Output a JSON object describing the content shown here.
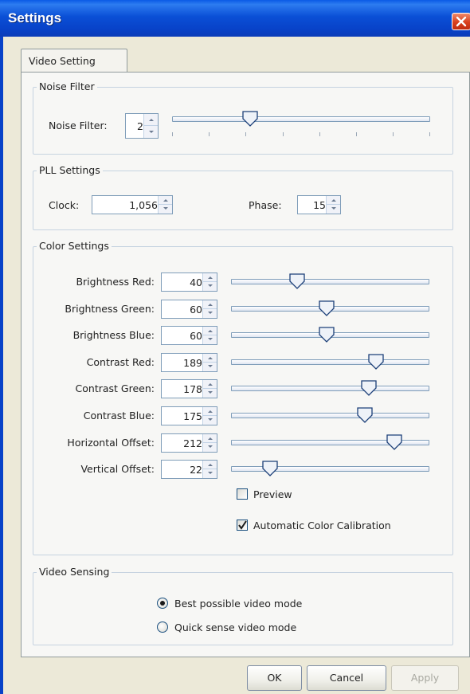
{
  "window": {
    "title": "Settings"
  },
  "tabs": [
    {
      "label": "Video Setting"
    }
  ],
  "noise_filter": {
    "legend": "Noise Filter",
    "label": "Noise Filter:",
    "value": "2",
    "slider_fraction": 0.29
  },
  "pll": {
    "legend": "PLL Settings",
    "clock_label": "Clock:",
    "clock_value": "1,056",
    "phase_label": "Phase:",
    "phase_value": "15"
  },
  "color": {
    "legend": "Color Settings",
    "rows": [
      {
        "label": "Brightness Red:",
        "value": "40",
        "fraction": 0.32
      },
      {
        "label": "Brightness Green:",
        "value": "60",
        "fraction": 0.48
      },
      {
        "label": "Brightness Blue:",
        "value": "60",
        "fraction": 0.48
      },
      {
        "label": "Contrast Red:",
        "value": "189",
        "fraction": 0.75
      },
      {
        "label": "Contrast Green:",
        "value": "178",
        "fraction": 0.71
      },
      {
        "label": "Contrast Blue:",
        "value": "175",
        "fraction": 0.69
      },
      {
        "label": "Horizontal Offset:",
        "value": "212",
        "fraction": 0.85
      },
      {
        "label": "Vertical Offset:",
        "value": "22",
        "fraction": 0.17
      }
    ],
    "preview_label": "Preview",
    "preview_checked": false,
    "auto_calib_label": "Automatic Color Calibration",
    "auto_calib_checked": true
  },
  "video_sensing": {
    "legend": "Video Sensing",
    "options": [
      {
        "label": "Best possible video mode",
        "selected": true
      },
      {
        "label": "Quick sense video mode",
        "selected": false
      }
    ]
  },
  "buttons": {
    "ok": "OK",
    "cancel": "Cancel",
    "apply": "Apply"
  }
}
